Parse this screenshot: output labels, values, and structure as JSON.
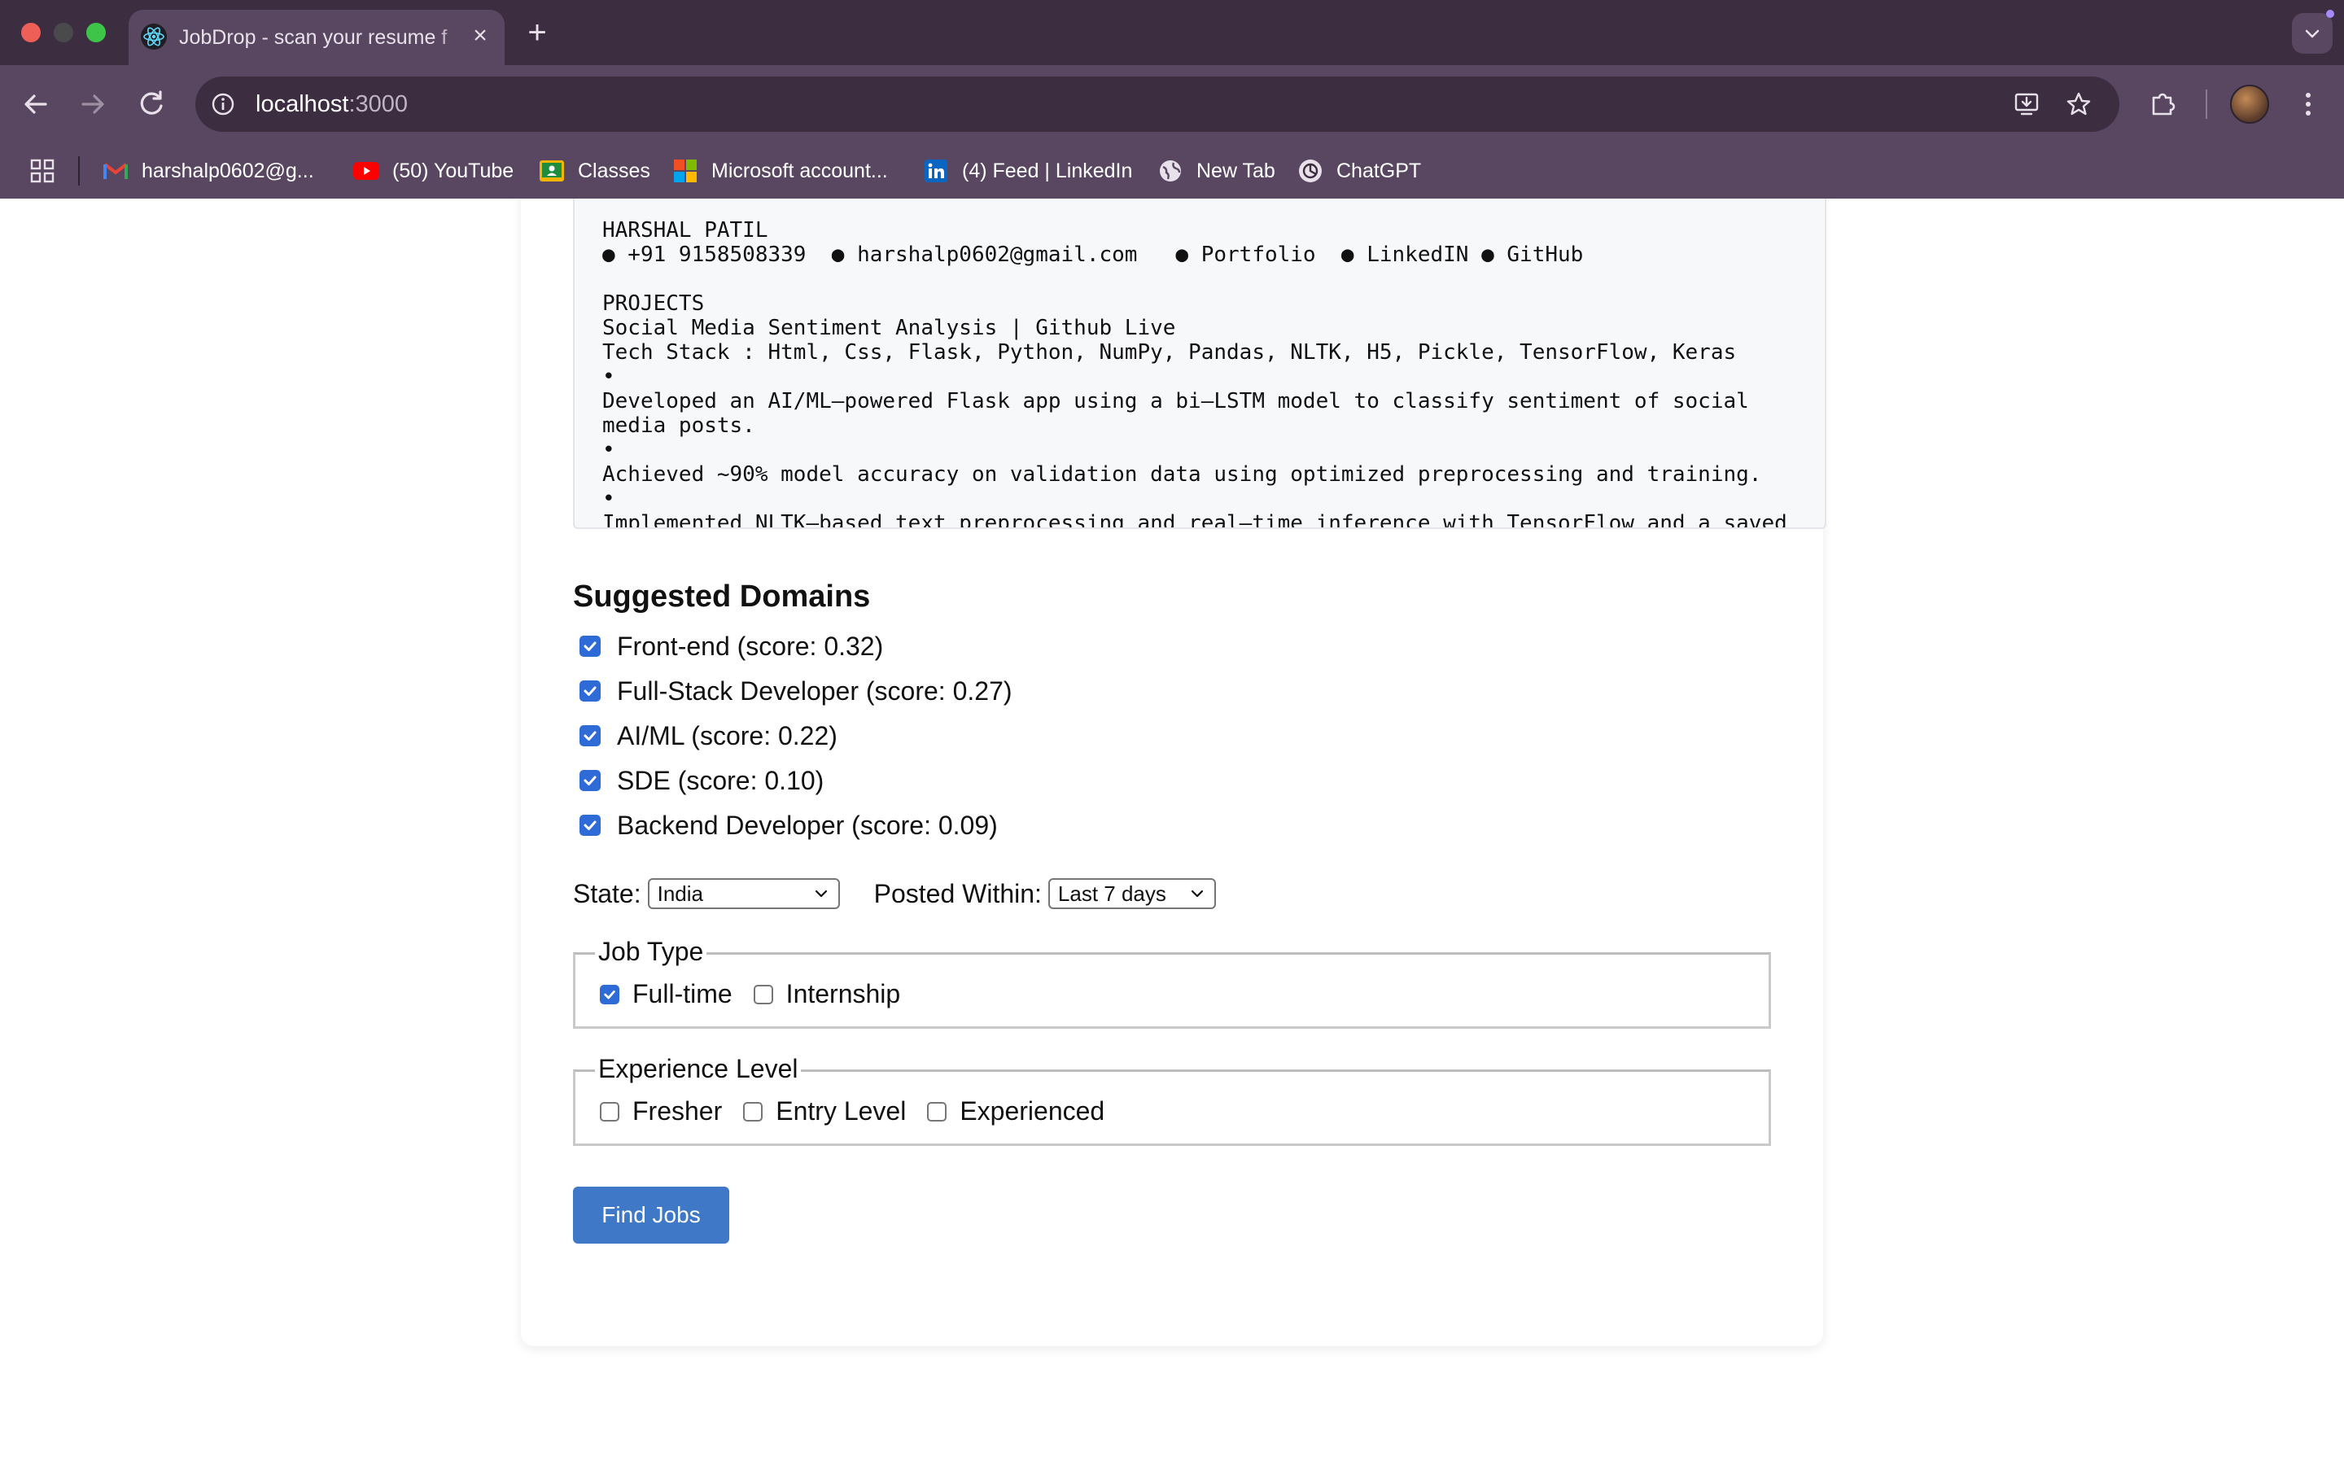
{
  "browser": {
    "tab": {
      "title": "JobDrop - scan your resume f",
      "favicon": "react-atom-icon"
    },
    "url": {
      "host": "localhost",
      "port": ":3000"
    },
    "bookmarks": [
      {
        "label": "harshalp0602@g...",
        "icon": "gmail-icon"
      },
      {
        "label": "(50) YouTube",
        "icon": "youtube-icon"
      },
      {
        "label": "Classes",
        "icon": "classroom-icon"
      },
      {
        "label": "Microsoft account...",
        "icon": "microsoft-icon"
      },
      {
        "label": "(4) Feed | LinkedIn",
        "icon": "linkedin-icon"
      },
      {
        "label": "New Tab",
        "icon": "globe-icon"
      },
      {
        "label": "ChatGPT",
        "icon": "chatgpt-icon"
      }
    ]
  },
  "resume": {
    "lines": [
      "HARSHAL PATIL",
      "● +91 9158508339  ● harshalp0602@gmail.com   ● Portfolio  ● LinkedIN ● GitHub",
      "",
      "PROJECTS",
      "Social Media Sentiment Analysis | Github Live",
      "Tech Stack : Html, Css, Flask, Python, NumPy, Pandas, NLTK, H5, Pickle, TensorFlow, Keras",
      "•",
      "Developed an AI/ML–powered Flask app using a bi–LSTM model to classify sentiment of social",
      "media posts.",
      "•",
      "Achieved ~90% model accuracy on validation data using optimized preprocessing and training.",
      "•",
      "Implemented NLTK–based text preprocessing and real–time inference with TensorFlow and a saved"
    ]
  },
  "suggested": {
    "title": "Suggested Domains",
    "domains": [
      {
        "label": "Front-end (score: 0.32)",
        "checked": true
      },
      {
        "label": "Full-Stack Developer (score: 0.27)",
        "checked": true
      },
      {
        "label": "AI/ML (score: 0.22)",
        "checked": true
      },
      {
        "label": "SDE (score: 0.10)",
        "checked": true
      },
      {
        "label": "Backend Developer (score: 0.09)",
        "checked": true
      }
    ]
  },
  "filters": {
    "state_label": "State:",
    "state_value": "India",
    "posted_label": "Posted Within:",
    "posted_value": "Last 7 days"
  },
  "job_type": {
    "legend": "Job Type",
    "options": [
      {
        "label": "Full-time",
        "checked": true
      },
      {
        "label": "Internship",
        "checked": false
      }
    ]
  },
  "experience": {
    "legend": "Experience Level",
    "options": [
      {
        "label": "Fresher",
        "checked": false
      },
      {
        "label": "Entry Level",
        "checked": false
      },
      {
        "label": "Experienced",
        "checked": false
      }
    ]
  },
  "actions": {
    "find_jobs": "Find Jobs"
  },
  "colors": {
    "accent": "#2f6bd6",
    "button": "#3e78c6",
    "chrome_dark": "#3c2d40",
    "chrome_light": "#594761"
  }
}
